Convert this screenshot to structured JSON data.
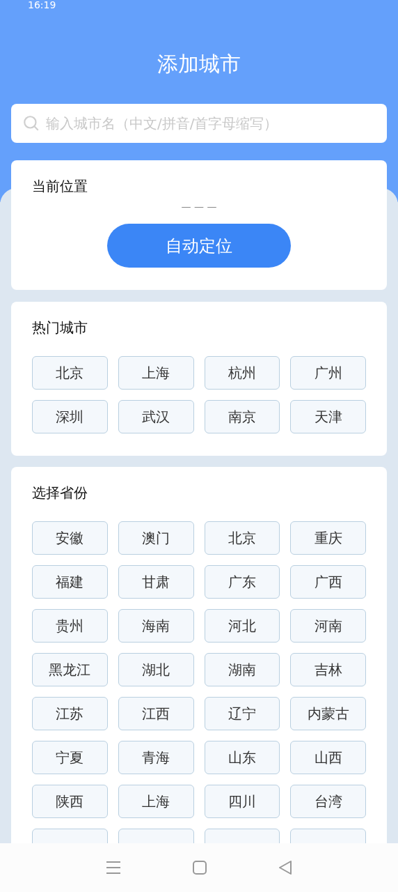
{
  "status_bar": {
    "time": "16:19"
  },
  "header": {
    "title": "添加城市"
  },
  "search": {
    "placeholder": "输入城市名（中文/拼音/首字母缩写）"
  },
  "current_location": {
    "title": "当前位置",
    "value": "— — —",
    "button": "自动定位"
  },
  "hot_cities": {
    "title": "热门城市",
    "items": [
      "北京",
      "上海",
      "杭州",
      "广州",
      "深圳",
      "武汉",
      "南京",
      "天津"
    ]
  },
  "provinces": {
    "title": "选择省份",
    "items": [
      "安徽",
      "澳门",
      "北京",
      "重庆",
      "福建",
      "甘肃",
      "广东",
      "广西",
      "贵州",
      "海南",
      "河北",
      "河南",
      "黑龙江",
      "湖北",
      "湖南",
      "吉林",
      "江苏",
      "江西",
      "辽宁",
      "内蒙古",
      "宁夏",
      "青海",
      "山东",
      "山西",
      "陕西",
      "上海",
      "四川",
      "台湾"
    ]
  }
}
